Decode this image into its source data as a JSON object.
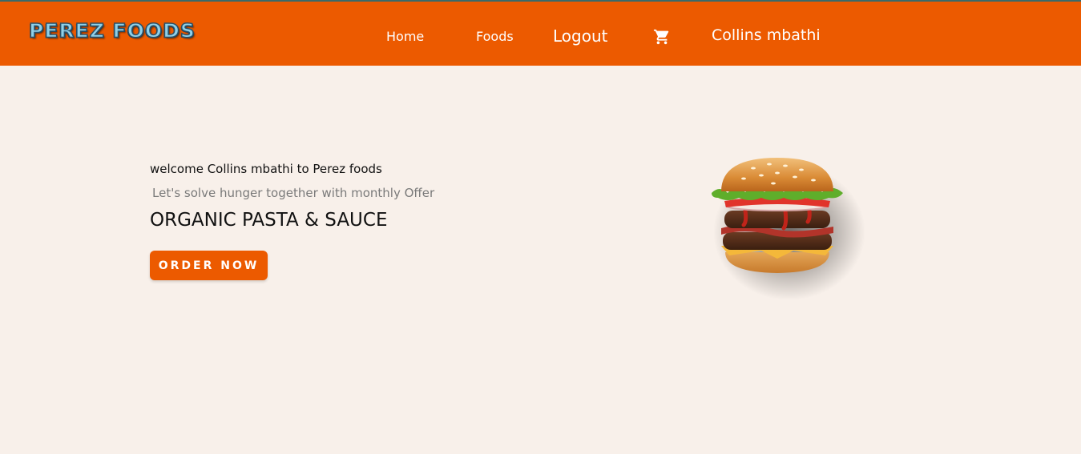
{
  "brand": {
    "logo_text": "PEREZ FOODS"
  },
  "nav": {
    "home": "Home",
    "foods": "Foods",
    "logout": "Logout",
    "cart_icon": "shopping-cart-icon",
    "user_name": "Collins mbathi"
  },
  "hero": {
    "welcome": "welcome Collins mbathi to Perez foods",
    "subtitle": " Let's solve hunger together with monthly Offer",
    "title": "ORGANIC PASTA & SAUCE",
    "cta": "ORDER NOW"
  },
  "colors": {
    "header": "#ec5a00",
    "background": "#f8f0ea",
    "accent": "#ec5a00"
  }
}
